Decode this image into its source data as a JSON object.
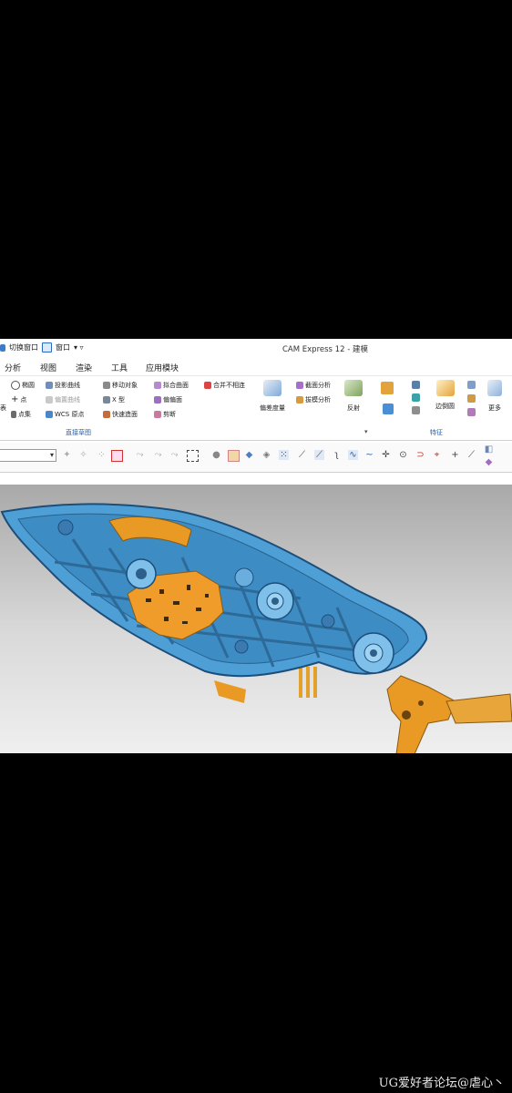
{
  "window": {
    "title": "CAM Express 12 - 建模",
    "quick_access": {
      "switch_window": "切换窗口",
      "window": "窗口",
      "dropdown": "▾ ▿"
    }
  },
  "menu": [
    "分析",
    "视图",
    "渲染",
    "工具",
    "应用模块"
  ],
  "ribbon": {
    "direct_sketch": {
      "group_label": "直接草图",
      "items": [
        "椭圆",
        "投影曲线",
        "移动对象",
        "拟合曲面",
        "合并不相连",
        "点",
        "偏置曲线",
        "X 型",
        "偏偏面",
        "点集",
        "WCS 原点",
        "快速造面",
        "剪断"
      ]
    },
    "analysis": {
      "big_buttons": [
        "偏差度量",
        "反射"
      ],
      "items": [
        "截面分析",
        "拔模分析"
      ]
    },
    "features": {
      "group_label": "特征",
      "big_buttons": [
        "边倒圆",
        "更多"
      ]
    }
  },
  "colors": {
    "accent": "#1f5fb5",
    "part_blue": "#4fa6dc",
    "part_orange": "#f0a22a"
  },
  "watermark": "UG爱好者论坛@虐心丶"
}
